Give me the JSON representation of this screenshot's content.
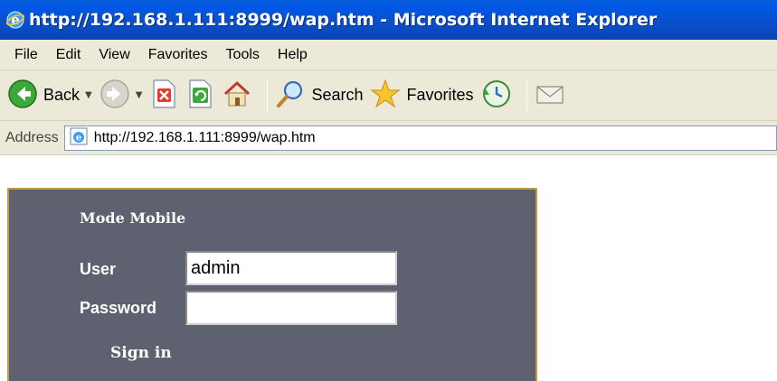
{
  "window": {
    "title": "http://192.168.1.111:8999/wap.htm - Microsoft Internet Explorer"
  },
  "menu": [
    "File",
    "Edit",
    "View",
    "Favorites",
    "Tools",
    "Help"
  ],
  "toolbar": {
    "back_label": "Back",
    "search_label": "Search",
    "favorites_label": "Favorites"
  },
  "address": {
    "label": "Address",
    "url": "http://192.168.1.111:8999/wap.htm"
  },
  "login": {
    "mode_title": "Mode Mobile",
    "user_label": "User",
    "user_value": "admin",
    "password_label": "Password",
    "password_value": "",
    "signin_label": "Sign in"
  },
  "colors": {
    "titlebar": "#0a4fc7",
    "chrome": "#ece9d8",
    "panel_bg": "#5e6170",
    "panel_border": "#c69a4a"
  }
}
